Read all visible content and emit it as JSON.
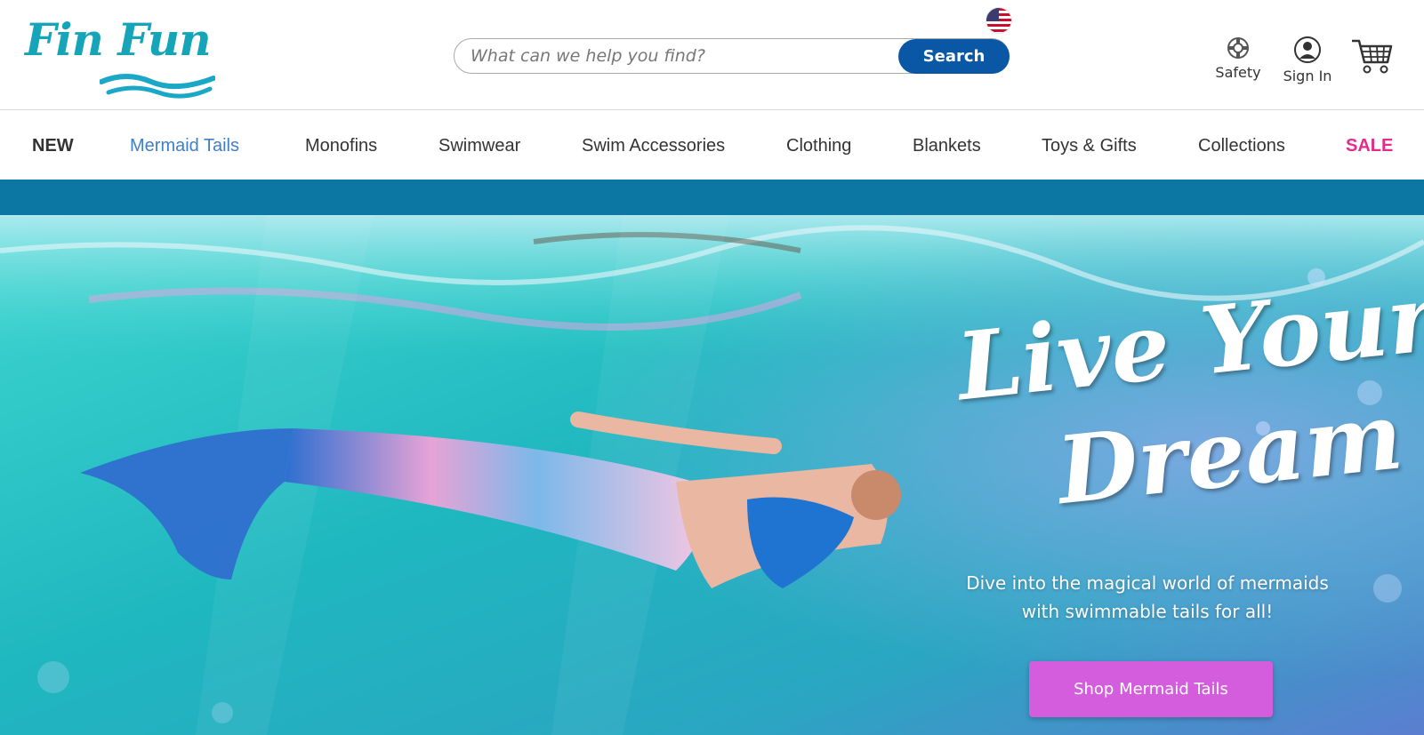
{
  "brand": {
    "logo_text": "Fin Fun",
    "colors": {
      "logo": "#16a5b8",
      "accent": "#0a57a5",
      "nav_active": "#3f7fc4",
      "sale": "#e32d8c",
      "band": "#0d77a3",
      "cta": "#d35ddc"
    }
  },
  "header": {
    "flag_icon": "us-flag-icon",
    "search": {
      "placeholder": "What can we help you find?",
      "value": "",
      "button_label": "Search"
    },
    "utilities": [
      {
        "label": "Safety",
        "icon": "lifebuoy-icon"
      },
      {
        "label": "Sign In",
        "icon": "user-icon"
      }
    ],
    "cart_icon": "shopping-cart-icon"
  },
  "nav": {
    "items": [
      {
        "label": "NEW"
      },
      {
        "label": "Mermaid Tails"
      },
      {
        "label": "Monofins"
      },
      {
        "label": "Swimwear"
      },
      {
        "label": "Swim Accessories"
      },
      {
        "label": "Clothing"
      },
      {
        "label": "Blankets"
      },
      {
        "label": "Toys & Gifts"
      },
      {
        "label": "Collections"
      },
      {
        "label": "SALE"
      }
    ]
  },
  "hero": {
    "headline_line1": "Live Your",
    "headline_line2": "Dream",
    "subtext_line1": "Dive into the magical world of mermaids",
    "subtext_line2": "with swimmable tails for all!",
    "cta_label": "Shop Mermaid Tails"
  }
}
